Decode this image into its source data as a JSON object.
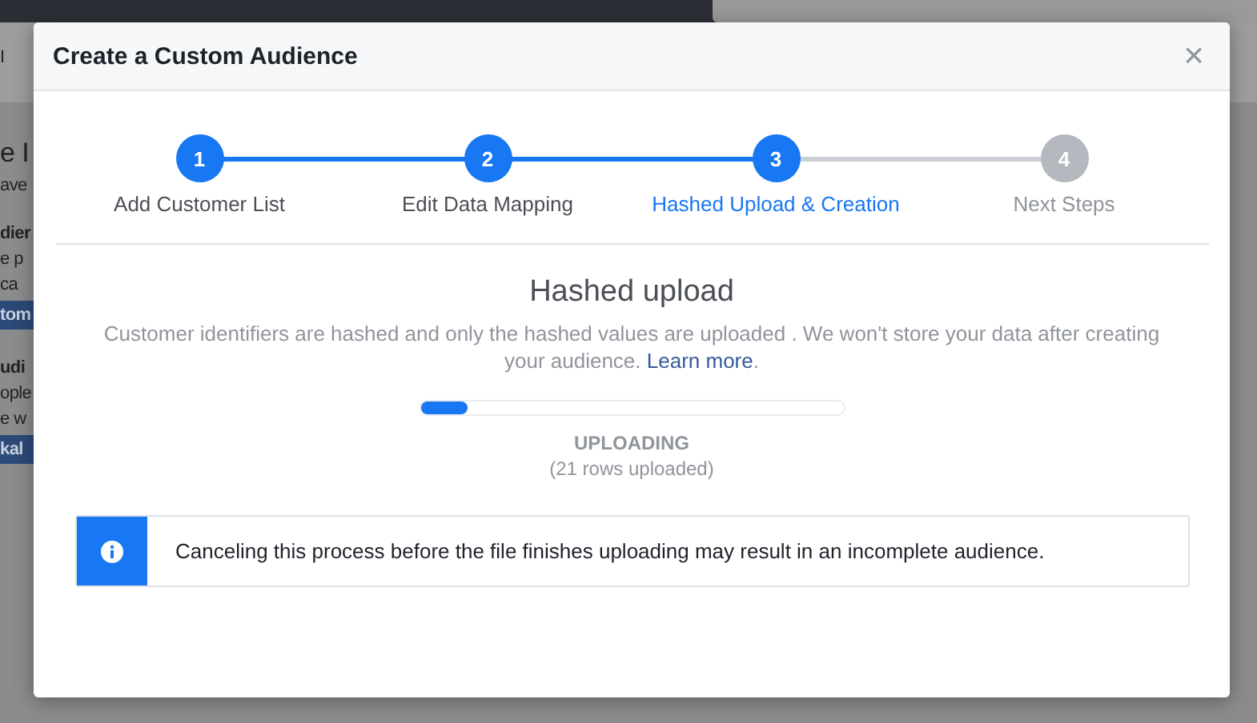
{
  "background": {
    "fragments": [
      {
        "kind": "text",
        "text": "I"
      },
      {
        "kind": "heading",
        "text": "e I"
      },
      {
        "kind": "text",
        "text": "ave"
      },
      {
        "kind": "bold",
        "text": "dier"
      },
      {
        "kind": "text",
        "text": "e p"
      },
      {
        "kind": "text",
        "text": "ca"
      },
      {
        "kind": "button",
        "text": "tom"
      },
      {
        "kind": "bold",
        "text": "udi"
      },
      {
        "kind": "text",
        "text": "ople"
      },
      {
        "kind": "text",
        "text": "e w"
      },
      {
        "kind": "button",
        "text": "kal"
      }
    ]
  },
  "dialog": {
    "title": "Create a Custom Audience",
    "close": "×",
    "steps": [
      {
        "number": "1",
        "label": "Add Customer List",
        "reached": true,
        "selected": false
      },
      {
        "number": "2",
        "label": "Edit Data Mapping",
        "reached": true,
        "selected": false
      },
      {
        "number": "3",
        "label": "Hashed Upload & Creation",
        "reached": true,
        "selected": true
      },
      {
        "number": "4",
        "label": "Next Steps",
        "reached": false,
        "selected": false
      }
    ],
    "heading": "Hashed upload",
    "description": "Customer identifiers are hashed and only the hashed values are uploaded . We won't store your data after creating your audience.",
    "link": "Learn more",
    "link_suffix": ".",
    "progress": {
      "level": 0.11,
      "status": "UPLOADING",
      "detail": "(21 rows uploaded)"
    },
    "notice": "Canceling this process before the file finishes uploading may result in an incomplete audience."
  }
}
